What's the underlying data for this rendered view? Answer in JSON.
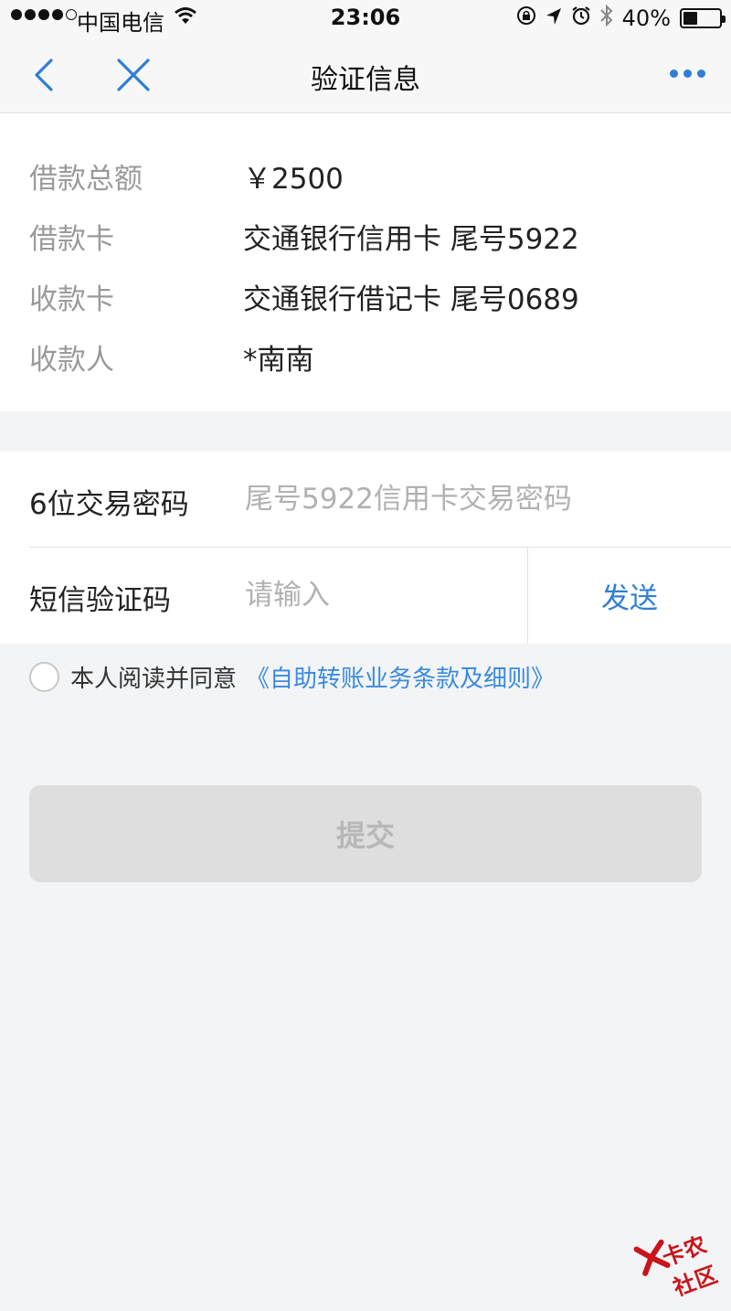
{
  "status_bar": {
    "carrier": "中国电信",
    "time": "23:06",
    "battery_percent": "40%",
    "battery_level": 0.4
  },
  "nav": {
    "title": "验证信息"
  },
  "loan_info": [
    {
      "label": "借款总额",
      "value": "￥2500"
    },
    {
      "label": "借款卡",
      "value": "交通银行信用卡 尾号5922"
    },
    {
      "label": "收款卡",
      "value": "交通银行借记卡 尾号0689"
    },
    {
      "label": "收款人",
      "value": "*南南"
    }
  ],
  "form": {
    "password_label": "6位交易密码",
    "password_placeholder": "尾号5922信用卡交易密码",
    "sms_label": "短信验证码",
    "sms_placeholder": "请输入",
    "send_label": "发送"
  },
  "agreement": {
    "text": "本人阅读并同意",
    "link": "《自助转账业务条款及细则》"
  },
  "submit_label": "提交",
  "watermark": {
    "text": "卡农社区",
    "color": "#c9141b"
  },
  "colors": {
    "accent": "#2f7fd3",
    "background": "#f3f4f6"
  }
}
